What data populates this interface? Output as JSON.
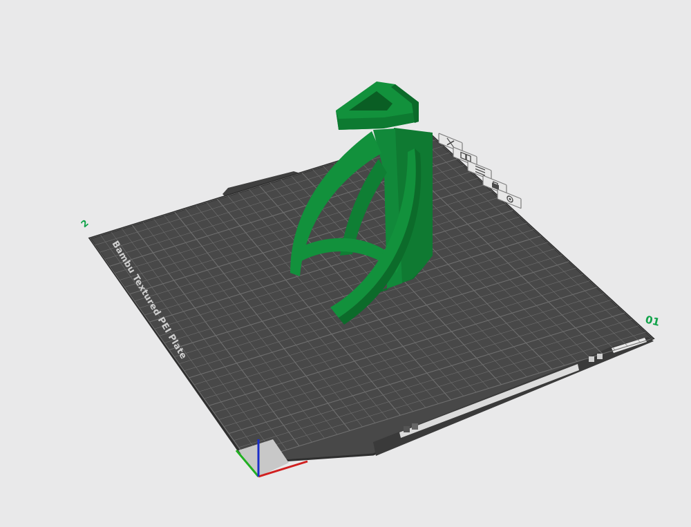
{
  "viewport": {
    "background": "#e9e9ea"
  },
  "plate": {
    "name": "Bambu Textured PEI Plate",
    "number": "01",
    "corner_mark": "2",
    "bed_color": "#484848",
    "grid_color": "#6f6f6f",
    "model_color": "#12913c"
  },
  "plate_toolbar": [
    {
      "name": "close-icon",
      "action": "delete-plate"
    },
    {
      "name": "arrange-icon",
      "action": "arrange"
    },
    {
      "name": "orient-icon",
      "action": "auto-orient"
    },
    {
      "name": "lock-icon",
      "action": "lock-plate"
    },
    {
      "name": "settings-icon",
      "action": "plate-settings"
    }
  ],
  "axes": {
    "x_color": "#d02020",
    "y_color": "#22b022",
    "z_color": "#1a2ec8"
  }
}
